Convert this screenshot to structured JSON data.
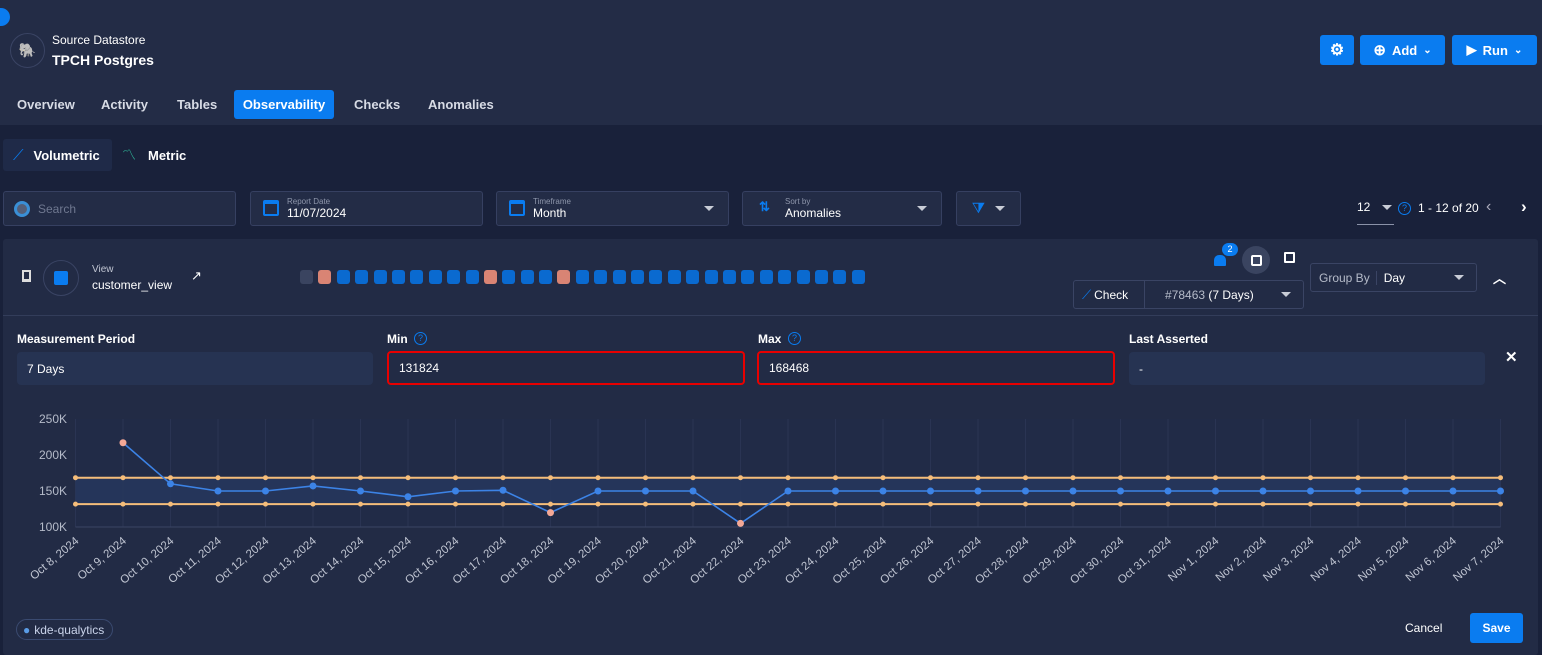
{
  "header": {
    "subtitle": "Source Datastore",
    "title": "TPCH Postgres",
    "settings_icon": "gear-icon",
    "add_label": "Add",
    "run_label": "Run"
  },
  "tabs": [
    {
      "label": "Overview"
    },
    {
      "label": "Activity"
    },
    {
      "label": "Tables"
    },
    {
      "label": "Observability",
      "active": true
    },
    {
      "label": "Checks"
    },
    {
      "label": "Anomalies"
    }
  ],
  "subtabs": [
    {
      "label": "Volumetric",
      "active": true
    },
    {
      "label": "Metric"
    }
  ],
  "filters": {
    "search_placeholder": "Search",
    "report_date_label": "Report Date",
    "report_date": "11/07/2024",
    "timeframe_label": "Timeframe",
    "timeframe": "Month",
    "sort_label": "Sort by",
    "sort": "Anomalies"
  },
  "pagination": {
    "page_size": "12",
    "range": "1 - 12 of 20"
  },
  "card": {
    "type": "View",
    "name": "customer_view",
    "notification_count": "2",
    "check_label": "Check",
    "check_id": "#78463",
    "check_period": "(7 Days)",
    "group_by_label": "Group By",
    "group_by": "Day",
    "status_squares": [
      "none",
      "anomaly",
      "ok",
      "ok",
      "ok",
      "ok",
      "ok",
      "ok",
      "ok",
      "ok",
      "anomaly",
      "ok",
      "ok",
      "ok",
      "anomaly",
      "ok",
      "ok",
      "ok",
      "ok",
      "ok",
      "ok",
      "ok",
      "ok",
      "ok",
      "ok",
      "ok",
      "ok",
      "ok",
      "ok",
      "ok",
      "ok"
    ],
    "measurement_period_label": "Measurement Period",
    "measurement_period": "7 Days",
    "min_label": "Min",
    "min": "131824",
    "max_label": "Max",
    "max": "168468",
    "last_asserted_label": "Last Asserted",
    "last_asserted": "-",
    "tag": "kde-qualytics",
    "cancel_label": "Cancel",
    "save_label": "Save"
  },
  "colors": {
    "accent": "#0a7cf0",
    "anomaly": "#d98474",
    "ok": "#0a6ad0",
    "threshold": "#f5bd7a",
    "line": "#3c83e6"
  },
  "chart_data": {
    "type": "line",
    "categories": [
      "Oct 8, 2024",
      "Oct 9, 2024",
      "Oct 10, 2024",
      "Oct 11, 2024",
      "Oct 12, 2024",
      "Oct 13, 2024",
      "Oct 14, 2024",
      "Oct 15, 2024",
      "Oct 16, 2024",
      "Oct 17, 2024",
      "Oct 18, 2024",
      "Oct 19, 2024",
      "Oct 20, 2024",
      "Oct 21, 2024",
      "Oct 22, 2024",
      "Oct 23, 2024",
      "Oct 24, 2024",
      "Oct 25, 2024",
      "Oct 26, 2024",
      "Oct 27, 2024",
      "Oct 28, 2024",
      "Oct 29, 2024",
      "Oct 30, 2024",
      "Oct 31, 2024",
      "Nov 1, 2024",
      "Nov 2, 2024",
      "Nov 3, 2024",
      "Nov 4, 2024",
      "Nov 5, 2024",
      "Nov 6, 2024",
      "Nov 7, 2024"
    ],
    "values": [
      null,
      217000,
      160000,
      150000,
      150000,
      157000,
      150000,
      142000,
      150000,
      151000,
      120000,
      150000,
      150000,
      150000,
      105000,
      150000,
      150000,
      150000,
      150000,
      150000,
      150000,
      150000,
      150000,
      150000,
      150000,
      150000,
      150000,
      150000,
      150000,
      150000,
      150000
    ],
    "anomalies": [
      1,
      10,
      14
    ],
    "min_threshold": 131824,
    "max_threshold": 168468,
    "yticks": [
      "100K",
      "150K",
      "200K",
      "250K"
    ],
    "ylim": [
      100000,
      250000
    ],
    "grid": true
  }
}
